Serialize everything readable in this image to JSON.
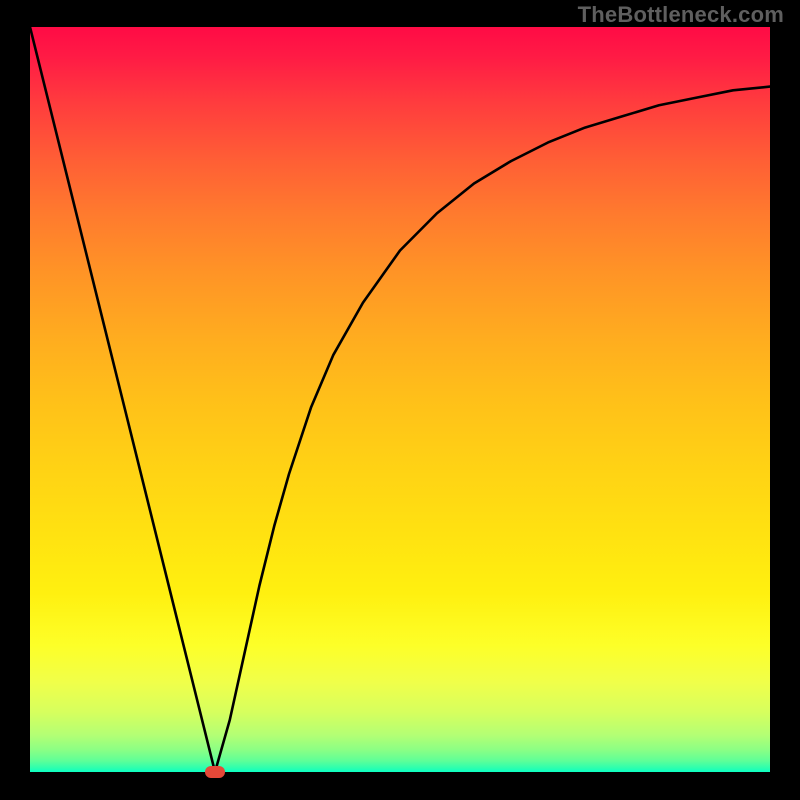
{
  "watermark": "TheBottleneck.com",
  "colors": {
    "frame_bg": "#000000",
    "curve": "#000000",
    "marker": "#e54838",
    "gradient_top": "#ff0b45",
    "gradient_bottom": "#0cffc3"
  },
  "chart_data": {
    "type": "line",
    "title": "",
    "xlabel": "",
    "ylabel": "",
    "xlim": [
      0,
      100
    ],
    "ylim": [
      0,
      100
    ],
    "grid": false,
    "legend": false,
    "annotations": [],
    "series": [
      {
        "name": "bottleneck-curve",
        "x": [
          0,
          5,
          10,
          15,
          20,
          22,
          24,
          25,
          27,
          29,
          31,
          33,
          35,
          38,
          41,
          45,
          50,
          55,
          60,
          65,
          70,
          75,
          80,
          85,
          90,
          95,
          100
        ],
        "values": [
          100,
          80,
          60,
          40,
          20,
          12,
          4,
          0,
          7,
          16,
          25,
          33,
          40,
          49,
          56,
          63,
          70,
          75,
          79,
          82,
          84.5,
          86.5,
          88,
          89.5,
          90.5,
          91.5,
          92
        ]
      }
    ],
    "marker": {
      "x": 25,
      "y": 0,
      "name": "optimal-point"
    }
  }
}
